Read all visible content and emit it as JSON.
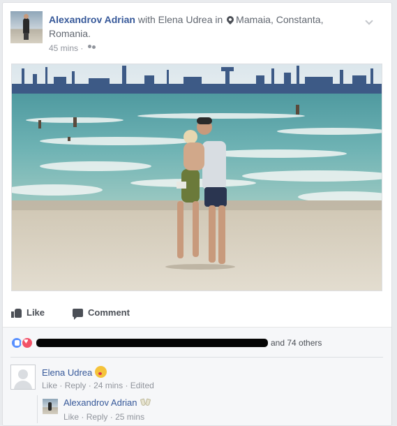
{
  "post": {
    "author": "Alexandrov Adrian",
    "with_text": "with",
    "tagged": "Elena Udrea",
    "in_text": "in",
    "location": "Mamaia, Constanta, Romania.",
    "time": "45 mins",
    "separator": "·",
    "audience_icon": "friends-icon",
    "menu_icon": "chevron-down-icon"
  },
  "actions": {
    "like_label": "Like",
    "comment_label": "Comment"
  },
  "reactions": {
    "icons": [
      "like-reaction-icon",
      "love-reaction-icon"
    ],
    "others_text": "and 74 others"
  },
  "comments": [
    {
      "author": "Elena Udrea",
      "emoji": "kissing-face-icon",
      "like": "Like",
      "reply": "Reply",
      "time": "24 mins",
      "edited": "Edited",
      "sep": "·"
    },
    {
      "author": "Alexandrov Adrian",
      "emoji": "clinking-glasses-icon",
      "like": "Like",
      "reply": "Reply",
      "time": "25 mins",
      "sep": "·"
    }
  ],
  "colors": {
    "link_blue": "#365899",
    "meta_gray": "#90949c",
    "like_blue": "#5890ff",
    "love_red": "#f25268"
  }
}
